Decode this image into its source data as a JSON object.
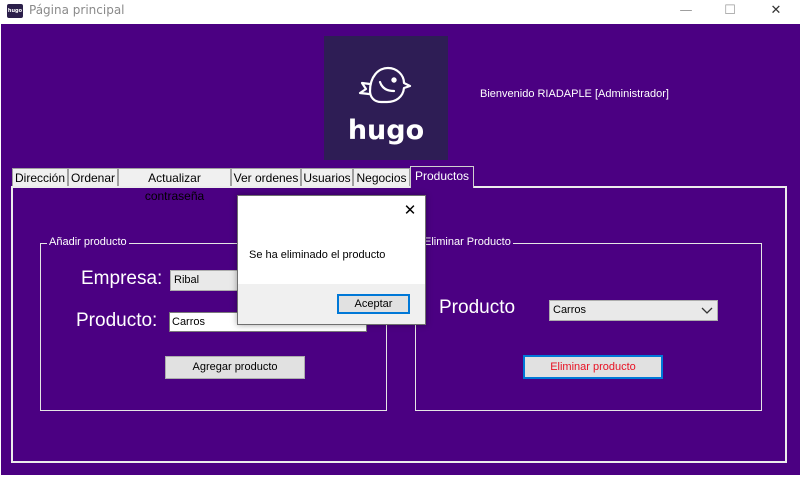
{
  "window": {
    "app_icon_text": "hugo",
    "title": "Página principal",
    "minimize": "—",
    "maximize": "☐",
    "close": "✕"
  },
  "header": {
    "logo_text": "hugo",
    "welcome": "Bienvenido RIADAPLE [Administrador]"
  },
  "tabs": [
    {
      "label": "Dirección"
    },
    {
      "label": "Ordenar"
    },
    {
      "label": "Actualizar contraseña"
    },
    {
      "label": "Ver ordenes"
    },
    {
      "label": "Usuarios"
    },
    {
      "label": "Negocios"
    },
    {
      "label": "Productos",
      "active": true
    }
  ],
  "add_product": {
    "group_title": "Añadir producto",
    "empresa_label": "Empresa:",
    "empresa_value": "Ribal",
    "producto_label": "Producto:",
    "producto_value": "Carros",
    "button": "Agregar producto"
  },
  "delete_product": {
    "group_title": "Eliminar Producto",
    "producto_label": "Producto",
    "producto_value": "Carros",
    "button": "Eliminar producto"
  },
  "dialog": {
    "message": "Se ha eliminado el producto",
    "ok_button": "Aceptar",
    "close": "✕"
  },
  "colors": {
    "background": "#4b0082",
    "logo_bg": "#2e1d55",
    "delete_text": "#e81123",
    "focus": "#0078d7"
  },
  "icons": {
    "dropdown": "chevron-down-icon",
    "logo": "bird-icon"
  }
}
